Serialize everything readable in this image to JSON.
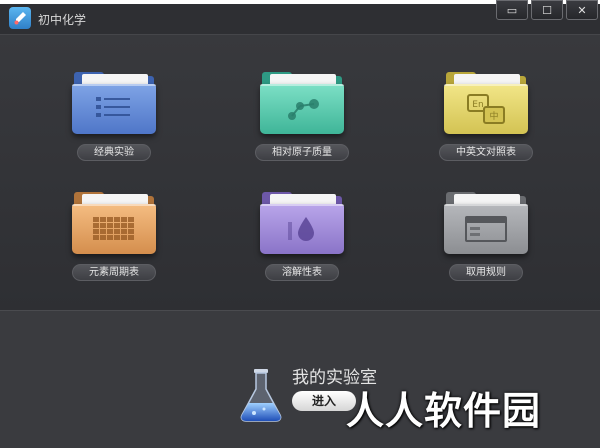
{
  "window": {
    "title": "初中化学",
    "minimize_label": "▭",
    "maximize_label": "☐",
    "close_label": "✕"
  },
  "modules": [
    {
      "label": "经典实验",
      "icon": "list-icon",
      "color": "#5b82d2"
    },
    {
      "label": "相对原子质量",
      "icon": "molecule-icon",
      "color": "#4fc3a6"
    },
    {
      "label": "中英文对照表",
      "icon": "translate-icon",
      "color": "#dccc5c",
      "icon_text_en": "En",
      "icon_text_cn": "中"
    },
    {
      "label": "元素周期表",
      "icon": "grid-icon",
      "color": "#e09a58"
    },
    {
      "label": "溶解性表",
      "icon": "drop-icon",
      "color": "#9a84d4"
    },
    {
      "label": "取用规则",
      "icon": "window-icon",
      "color": "#9a9ca0"
    }
  ],
  "lab": {
    "title": "我的实验室",
    "enter_label": "进入",
    "icon": "flask-icon"
  },
  "watermark": "人人软件园"
}
